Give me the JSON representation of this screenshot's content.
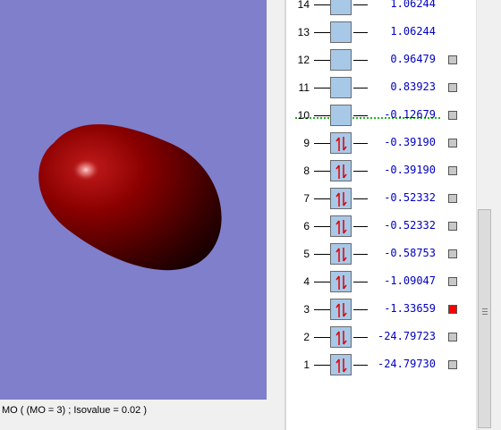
{
  "viewport": {
    "background": "#7f7fcc",
    "orbital_color": "#8b0000"
  },
  "status_bar": {
    "text": "MO ( (MO = 3) ; Isovalue = 0.02 )"
  },
  "orbitals": [
    {
      "number": "14",
      "energy": "1.06244",
      "occupied": false,
      "checkbox": false,
      "selected": false
    },
    {
      "number": "13",
      "energy": "1.06244",
      "occupied": false,
      "checkbox": false,
      "selected": false
    },
    {
      "number": "12",
      "energy": "0.96479",
      "occupied": false,
      "checkbox": true,
      "selected": false
    },
    {
      "number": "11",
      "energy": "0.83923",
      "occupied": false,
      "checkbox": true,
      "selected": false
    },
    {
      "number": "10",
      "energy": "-0.12679",
      "occupied": false,
      "checkbox": true,
      "selected": false
    },
    {
      "number": "9",
      "energy": "-0.39190",
      "occupied": true,
      "checkbox": true,
      "selected": false
    },
    {
      "number": "8",
      "energy": "-0.39190",
      "occupied": true,
      "checkbox": true,
      "selected": false
    },
    {
      "number": "7",
      "energy": "-0.52332",
      "occupied": true,
      "checkbox": true,
      "selected": false
    },
    {
      "number": "6",
      "energy": "-0.52332",
      "occupied": true,
      "checkbox": true,
      "selected": false
    },
    {
      "number": "5",
      "energy": "-0.58753",
      "occupied": true,
      "checkbox": true,
      "selected": false
    },
    {
      "number": "4",
      "energy": "-1.09047",
      "occupied": true,
      "checkbox": true,
      "selected": false
    },
    {
      "number": "3",
      "energy": "-1.33659",
      "occupied": true,
      "checkbox": true,
      "selected": true
    },
    {
      "number": "2",
      "energy": "-24.79723",
      "occupied": true,
      "checkbox": true,
      "selected": false
    },
    {
      "number": "1",
      "energy": "-24.79730",
      "occupied": true,
      "checkbox": true,
      "selected": false
    }
  ],
  "colors": {
    "energy_text": "#0000c0",
    "level_box": "#a8c8e8",
    "spin_arrow": "#e00000",
    "homo_lumo_gap": "#1fb41f",
    "selected_checkbox": "#ff0000"
  }
}
